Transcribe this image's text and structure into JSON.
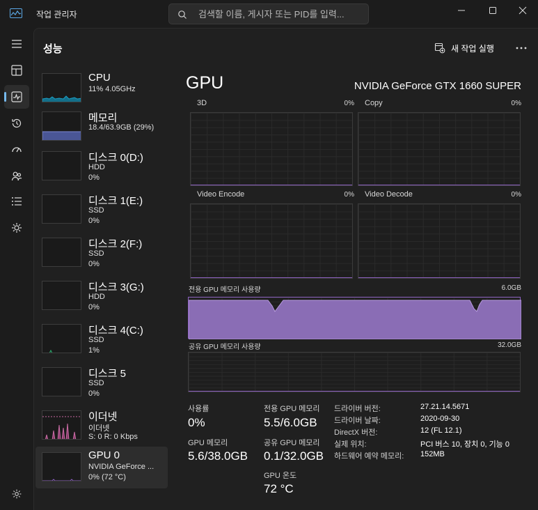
{
  "window": {
    "title": "작업 관리자",
    "app_icon": "task-manager-icon"
  },
  "search": {
    "placeholder": "검색할 이름, 게시자 또는 PID를 입력...",
    "icon": "search-icon"
  },
  "nav": {
    "items": [
      "processes-icon",
      "performance-icon",
      "app-history-icon",
      "startup-apps-icon",
      "users-icon",
      "details-icon",
      "services-icon"
    ],
    "active": "performance-icon",
    "settings_icon": "gear-icon"
  },
  "header": {
    "page_title": "성능",
    "run_new_task": "새 작업 실행",
    "more_icon": "more-icon"
  },
  "devices": [
    {
      "name": "CPU",
      "line1": "11% 4.05GHz",
      "line2": ""
    },
    {
      "name": "메모리",
      "line1": "18.4/63.9GB (29%)",
      "line2": ""
    },
    {
      "name": "디스크 0(D:)",
      "line1": "HDD",
      "line2": "0%"
    },
    {
      "name": "디스크 1(E:)",
      "line1": "SSD",
      "line2": "0%"
    },
    {
      "name": "디스크 2(F:)",
      "line1": "SSD",
      "line2": "0%"
    },
    {
      "name": "디스크 3(G:)",
      "line1": "HDD",
      "line2": "0%"
    },
    {
      "name": "디스크 4(C:)",
      "line1": "SSD",
      "line2": "1%"
    },
    {
      "name": "디스크 5",
      "line1": "SSD",
      "line2": "0%"
    },
    {
      "name": "이더넷",
      "line1": "이더넷",
      "line2": "S: 0  R: 0 Kbps"
    },
    {
      "name": "GPU 0",
      "line1": "NVIDIA GeForce ...",
      "line2": "0% (72 °C)"
    }
  ],
  "gpu": {
    "title": "GPU",
    "model": "NVIDIA GeForce GTX 1660 SUPER",
    "engines": [
      {
        "label": "3D",
        "pct": "0%"
      },
      {
        "label": "Copy",
        "pct": "0%"
      },
      {
        "label": "Video Encode",
        "pct": "0%"
      },
      {
        "label": "Video Decode",
        "pct": "0%"
      }
    ],
    "dedicated_label": "전용 GPU 메모리 사용량",
    "dedicated_max": "6.0GB",
    "shared_label": "공유 GPU 메모리 사용량",
    "shared_max": "32.0GB",
    "colors": {
      "gpu": "#8b5fbf",
      "gpu_fill": "#6d4f93",
      "cpu": "#1ba1c7",
      "memory": "#7c88d6",
      "disk": "#2bb673",
      "ethernet": "#c96ba4"
    }
  },
  "stats": {
    "utilization_label": "사용률",
    "utilization_value": "0%",
    "dedicated_label": "전용 GPU 메모리",
    "dedicated_value": "5.5/6.0GB",
    "gpu_memory_label": "GPU 메모리",
    "gpu_memory_value": "5.6/38.0GB",
    "shared_label": "공유 GPU 메모리",
    "shared_value": "0.1/32.0GB",
    "temp_label": "GPU 온도",
    "temp_value": "72 °C"
  },
  "info": [
    {
      "key": "드라이버 버전:",
      "value": "27.21.14.5671"
    },
    {
      "key": "드라이버 날짜:",
      "value": "2020-09-30"
    },
    {
      "key": "DirectX 버전:",
      "value": "12 (FL 12.1)"
    },
    {
      "key": "실제 위치:",
      "value": "PCI 버스 10, 장치 0, 기능 0"
    },
    {
      "key": "하드웨어 예약 메모리:",
      "value": "152MB"
    }
  ]
}
